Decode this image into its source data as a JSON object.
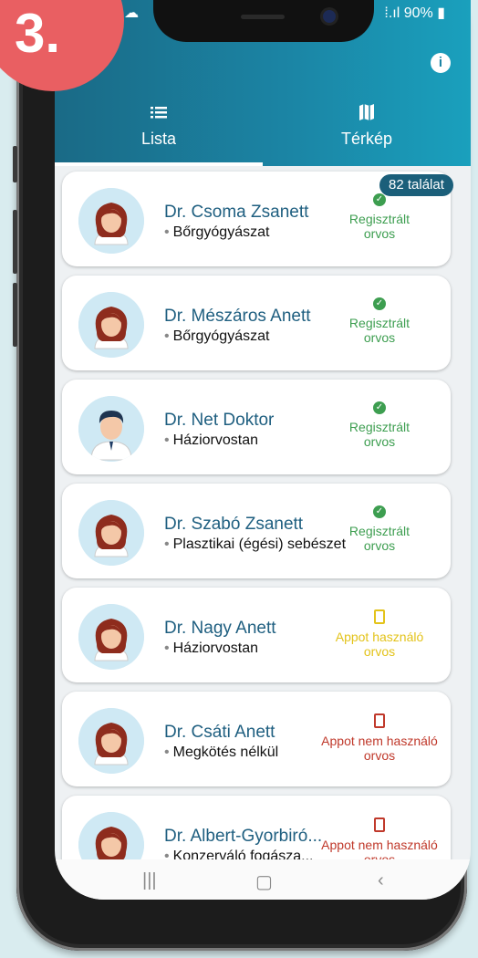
{
  "step": "3.",
  "status_bar": {
    "left_icons": "▪ ☁",
    "battery": "90%"
  },
  "tabs": [
    {
      "label": "Lista",
      "icon": "list-icon"
    },
    {
      "label": "Térkép",
      "icon": "map-icon"
    }
  ],
  "result_count": "82 találat",
  "doctors": [
    {
      "name": "Dr. Csoma Zsanett",
      "specialty": "Bőrgyógyászat",
      "status_line1": "Regisztrált",
      "status_line2": "orvos",
      "status_type": "registered",
      "avatar": "female"
    },
    {
      "name": "Dr. Mészáros Anett",
      "specialty": "Bőrgyógyászat",
      "status_line1": "Regisztrált",
      "status_line2": "orvos",
      "status_type": "registered",
      "avatar": "female"
    },
    {
      "name": "Dr. Net Doktor",
      "specialty": "Háziorvostan",
      "status_line1": "Regisztrált",
      "status_line2": "orvos",
      "status_type": "registered",
      "avatar": "male"
    },
    {
      "name": "Dr. Szabó Zsanett",
      "specialty": "Plasztikai (égési) sebészet",
      "status_line1": "Regisztrált",
      "status_line2": "orvos",
      "status_type": "registered",
      "avatar": "female"
    },
    {
      "name": "Dr. Nagy Anett",
      "specialty": "Háziorvostan",
      "status_line1": "Appot használó",
      "status_line2": "orvos",
      "status_type": "app-user",
      "avatar": "female"
    },
    {
      "name": "Dr. Csáti Anett",
      "specialty": "Megkötés nélkül",
      "status_line1": "Appot nem használó",
      "status_line2": "orvos",
      "status_type": "non-app-user",
      "avatar": "female"
    },
    {
      "name": "Dr.  Albert-Gyorbiró...",
      "specialty": "Konzerváló fogásza...",
      "status_line1": "Appot nem használó",
      "status_line2": "orvos",
      "status_type": "non-app-user",
      "avatar": "female"
    }
  ],
  "colors": {
    "registered": "#3d9e50",
    "app_user": "#e3c31a",
    "non_app_user": "#c0392b",
    "header": "#1b84a4"
  }
}
